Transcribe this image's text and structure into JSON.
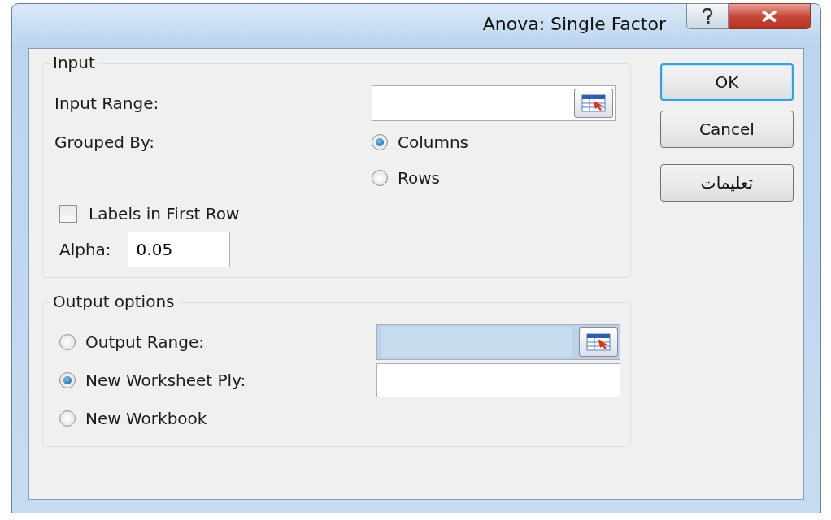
{
  "window": {
    "title": "Anova: Single Factor"
  },
  "input": {
    "title": "Input",
    "input_range": {
      "label": "Input Range:"
    },
    "grouped_by": {
      "label": "Grouped By:",
      "options": [
        {
          "label": "Columns",
          "selected": true
        },
        {
          "label": "Rows",
          "selected": false
        }
      ]
    },
    "labels_in_first_row": {
      "label": "Labels in First Row",
      "checked": false
    },
    "alpha": {
      "label": "Alpha:",
      "value": "0.05"
    }
  },
  "output": {
    "title": "Output options",
    "options": [
      {
        "label": "Output Range:",
        "selected": false,
        "kind": "range"
      },
      {
        "label": "New Worksheet Ply:",
        "selected": true,
        "kind": "text"
      },
      {
        "label": "New Workbook",
        "selected": false,
        "kind": "none"
      }
    ]
  },
  "buttons": [
    {
      "label": "OK",
      "default": true
    },
    {
      "label": "Cancel",
      "default": false
    },
    {
      "label": "تعليمات",
      "default": false
    }
  ]
}
